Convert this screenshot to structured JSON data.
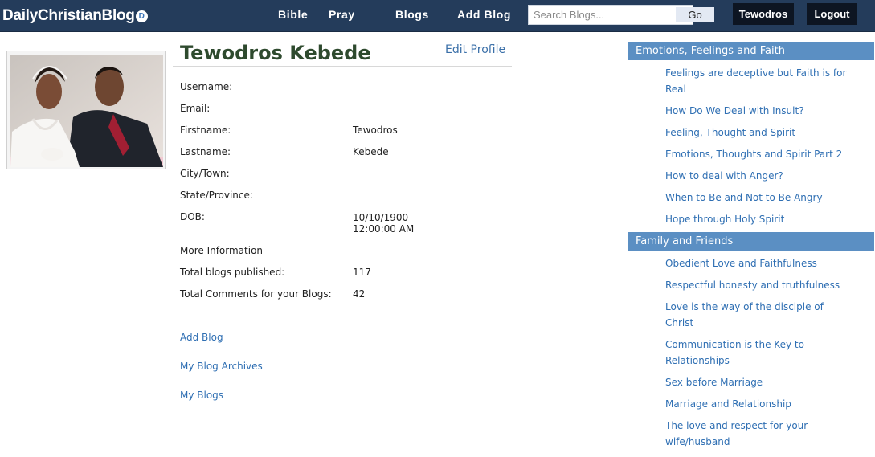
{
  "brand": {
    "name": "DailyChristianBlog",
    "icon": "logo-badge-icon"
  },
  "nav": {
    "bible": "Bible",
    "pray": "Pray",
    "blogs": "Blogs",
    "add_blog": "Add Blog"
  },
  "search": {
    "placeholder": "Search Blogs...",
    "button": "Go"
  },
  "user": {
    "name": "Tewodros",
    "logout": "Logout"
  },
  "profile": {
    "full_name": "Tewodros Kebede",
    "edit_label": "Edit Profile",
    "fields": [
      {
        "label": "Username:",
        "value": ""
      },
      {
        "label": "Email:",
        "value": ""
      },
      {
        "label": "Firstname:",
        "value": "Tewodros"
      },
      {
        "label": "Lastname:",
        "value": "Kebede"
      },
      {
        "label": "City/Town:",
        "value": ""
      },
      {
        "label": "State/Province:",
        "value": ""
      },
      {
        "label": "DOB:",
        "value": "10/10/1900\n12:00:00 AM"
      },
      {
        "label": "More Information",
        "value": ""
      },
      {
        "label": "Total blogs published:",
        "value": "117"
      },
      {
        "label": "Total Comments for your Blogs:",
        "value": "42"
      }
    ],
    "links": [
      "Add Blog",
      "My Blog Archives",
      "My Blogs"
    ]
  },
  "sidebar": {
    "categories": [
      {
        "title": "Emotions, Feelings and Faith",
        "posts": [
          "Feelings are deceptive but Faith is for Real",
          "How Do We Deal with Insult?",
          "Feeling, Thought and Spirit",
          "Emotions, Thoughts and Spirit Part 2",
          "How to deal with Anger?",
          "When to Be and Not to Be Angry",
          "Hope through Holy Spirit"
        ]
      },
      {
        "title": "Family and Friends",
        "posts": [
          "Obedient Love and Faithfulness",
          "Respectful honesty and truthfulness",
          "Love is the way of the disciple of Christ",
          "Communication is the Key to Relationships",
          "Sex before Marriage",
          "Marriage and Relationship",
          "The love and respect for your wife/husband"
        ]
      }
    ]
  },
  "colors": {
    "header_bg": "#243c5b",
    "category_bg": "#5b8fc3",
    "link": "#2f6fb3",
    "name_green": "#2e4a2e"
  }
}
